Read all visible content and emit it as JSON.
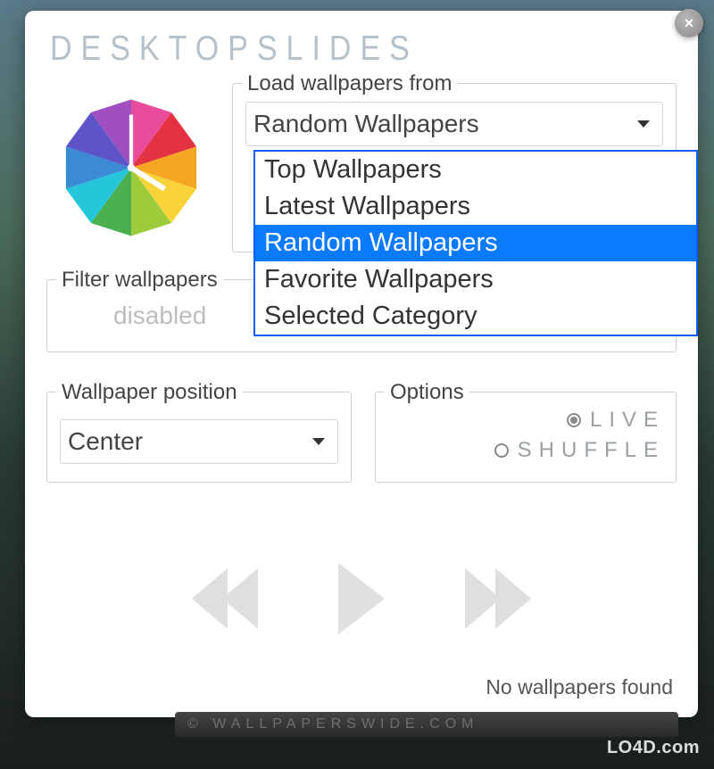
{
  "brand": "DESKTOPSLIDES",
  "close_glyph": "×",
  "load": {
    "label": "Load wallpapers from",
    "value": "Random Wallpapers",
    "options": [
      "Top Wallpapers",
      "Latest Wallpapers",
      "Random Wallpapers",
      "Favorite Wallpapers",
      "Selected Category"
    ],
    "selected_index": 2
  },
  "filter": {
    "label": "Filter wallpapers",
    "value": "disabled"
  },
  "position": {
    "label": "Wallpaper position",
    "value": "Center"
  },
  "options": {
    "label": "Options",
    "live": "LIVE",
    "shuffle": "SHUFFLE",
    "selected": "live"
  },
  "status": "No wallpapers found",
  "footer": "© WALLPAPERSWIDE.COM",
  "watermark": "LO4D.com"
}
